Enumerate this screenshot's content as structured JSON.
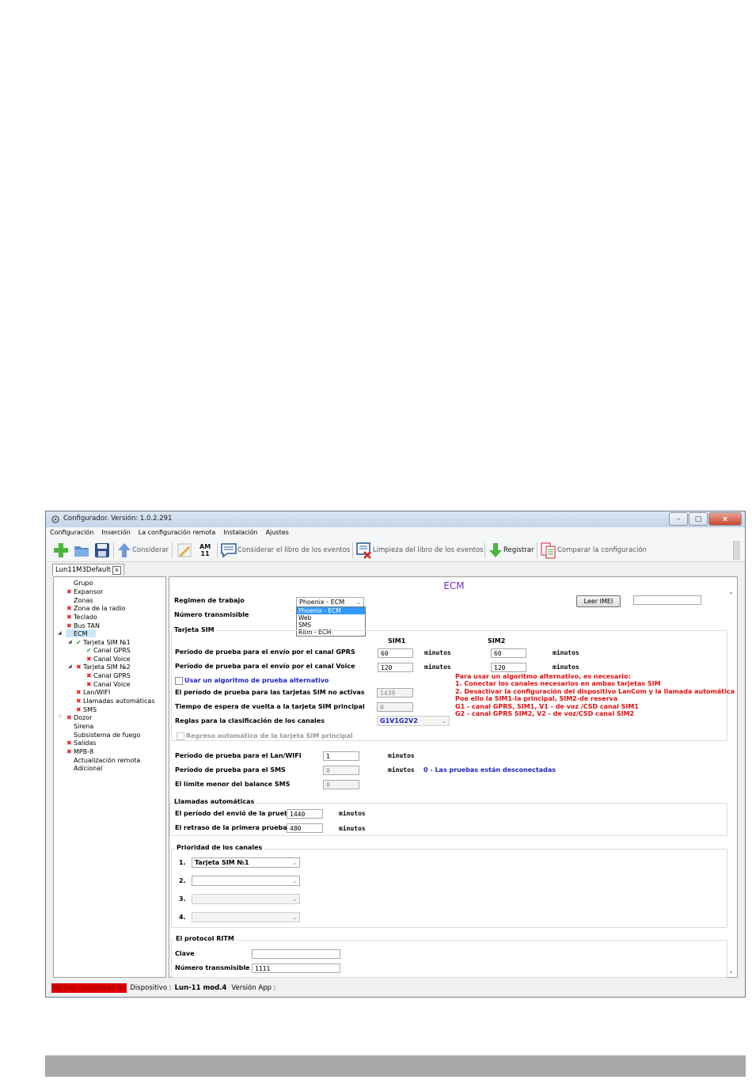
{
  "window": {
    "title": "Configurador. Versión: 1.0.2.291",
    "buttons": {
      "minimize": "–",
      "maximize": "□",
      "close": "x"
    }
  },
  "menu": [
    "Configuración",
    "Inserción",
    "La configuración remota",
    "Instalación",
    "Ajustes"
  ],
  "toolbar": {
    "considerar": "Considerar",
    "am": "AM",
    "am_num": "11",
    "considerar_libro": "Considerar el libro de los eventos",
    "limpieza": "Limpieza del libro de los eventos",
    "registrar": "Registrar",
    "comparar": "Comparar la configuración"
  },
  "doc_tab": {
    "label": "Lun11M3Default",
    "close": "x"
  },
  "tree": {
    "grupo": "Grupo",
    "expansor": "Expansor",
    "zonas": "Zonas",
    "zona_radio": "Zona de la radio",
    "teclado": "Teclado",
    "bus_tan": "Bus TAN",
    "ecm": "ECM",
    "sim1": "Tarjeta SIM №1",
    "sim1_gprs": "Canal GPRS",
    "sim1_voice": "Canal Voice",
    "sim2": "Tarjeta SIM №2",
    "sim2_gprs": "Canal GPRS",
    "sim2_voice": "Canal Voice",
    "lan": "Lan/WIFI",
    "llamadas": "Llamadas automáticas",
    "sms": "SMS",
    "dozor": "Dozor",
    "sirena": "Sirena",
    "fuego": "Subsistema de fuego",
    "salidas": "Salidas",
    "mpb": "MPB-8",
    "actualizacion": "Actualización remota",
    "adicional": "Adicional"
  },
  "main": {
    "heading": "ECM",
    "regimen_label": "Regimen de trabajo",
    "regimen_value": "Phoenix - ECM",
    "regimen_options": [
      "Phoenix - ECM",
      "Web",
      "SMS",
      "Ritm - ECM"
    ],
    "numero_label": "Número transmisible",
    "leer_imei": "Leer IMEI",
    "imei_value": "",
    "sim_group": "Tarjeta SIM",
    "sim1_head": "SIM1",
    "sim2_head": "SIM2",
    "gprs_label": "Período de prueba para el envío por el canal GPRS",
    "gprs_sim1": "60",
    "gprs_sim2": "60",
    "voice_label": "Período de prueba para el envío por el canal Voice",
    "voice_sim1": "120",
    "voice_sim2": "120",
    "minutos": "minutos",
    "alt_label": "Usar un algoritmo de prueba alternativo",
    "inactive_label": "El período de prueba para las tarjetas SIM no activas",
    "inactive_value": "1439",
    "wait_label": "Tiempo de espera de vuelta a la tarjeta SIM principal",
    "wait_value": "0",
    "rules_label": "Reglas para la clasificación de los canales",
    "rules_value": "G1V1G2V2",
    "return_label": "Regreso automático de la tarjeta SIM principal",
    "note": [
      "Para usar un algoritmo alternativo, es necesario:",
      "1. Conectar los canales necesarios en ambas tarjetas SIM",
      "2. Desactivar la configuración del dispositivo LanCom y la llamada automática",
      "Poe ello la SIM1-la principal, SIM2-de reserva",
      "G1 - canal GPRS, SIM1, V1 - de voz /CSD canal SIM1",
      "G2 - canal GPRS SIM2, V2 - de voz/CSD canal SIM2"
    ],
    "lan_label": "Período de prueba para el  Lan/WIFI",
    "lan_value": "1",
    "sms_label": "Período de prueba para el  SMS",
    "sms_value": "0",
    "sms_info": "0 - Las pruebas están desconectadas",
    "balance_label": "El límite menor del balance SMS",
    "balance_value": "0",
    "llamadas_group": "Llamadas automáticas",
    "call_period_label": "El período del envió de la prueba",
    "call_period_value": "1440",
    "call_delay_label": "El retraso de la primera prueba",
    "call_delay_value": "480",
    "prio_group": "Prioridad de los canales",
    "prio_1": "1.",
    "prio_2": "2.",
    "prio_3": "3.",
    "prio_4": "4.",
    "prio_1_value": "Tarjeta SIM  №1",
    "ritm_group": "El protocol RITM",
    "clave_label": "Clave",
    "clave_value": "",
    "ritm_num_label": "Número transmisible",
    "ritm_num_value": "1111"
  },
  "status": {
    "nocom": "No hay comunicación",
    "dispositivo_label": "Dispositivo :",
    "dispositivo_value": "Lun-11 mod.4",
    "version_label": "Versión App :"
  },
  "colors": {
    "accent_heading": "#7a2bc0",
    "error_red": "#e02020",
    "ok_green": "#2e9e2e",
    "link_blue": "#1c25c4"
  }
}
